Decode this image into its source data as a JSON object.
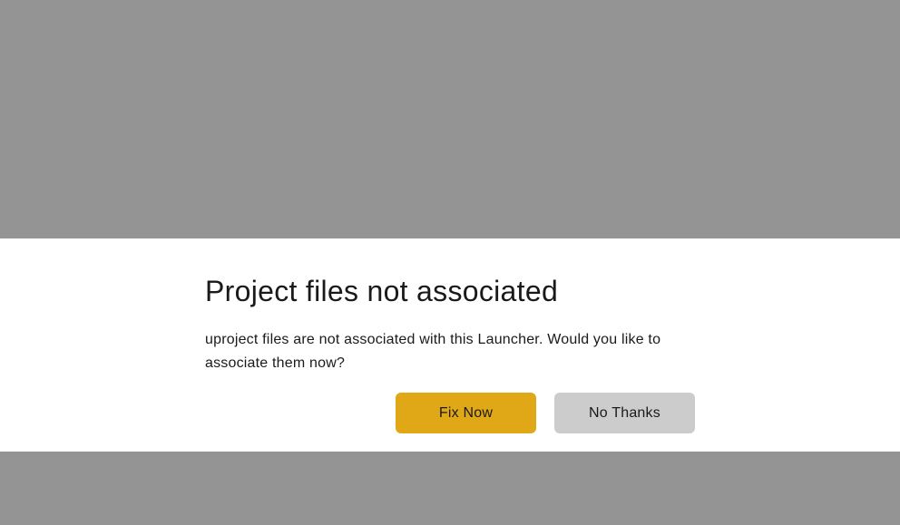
{
  "dialog": {
    "title": "Project files not associated",
    "message": "uproject files are not associated with this Launcher. Would you like to associate them now?",
    "buttons": {
      "primary_label": "Fix Now",
      "secondary_label": "No Thanks"
    }
  },
  "colors": {
    "backdrop": "#949494",
    "panel": "#ffffff",
    "primary_button": "#e0a817",
    "secondary_button": "#cccccc"
  }
}
